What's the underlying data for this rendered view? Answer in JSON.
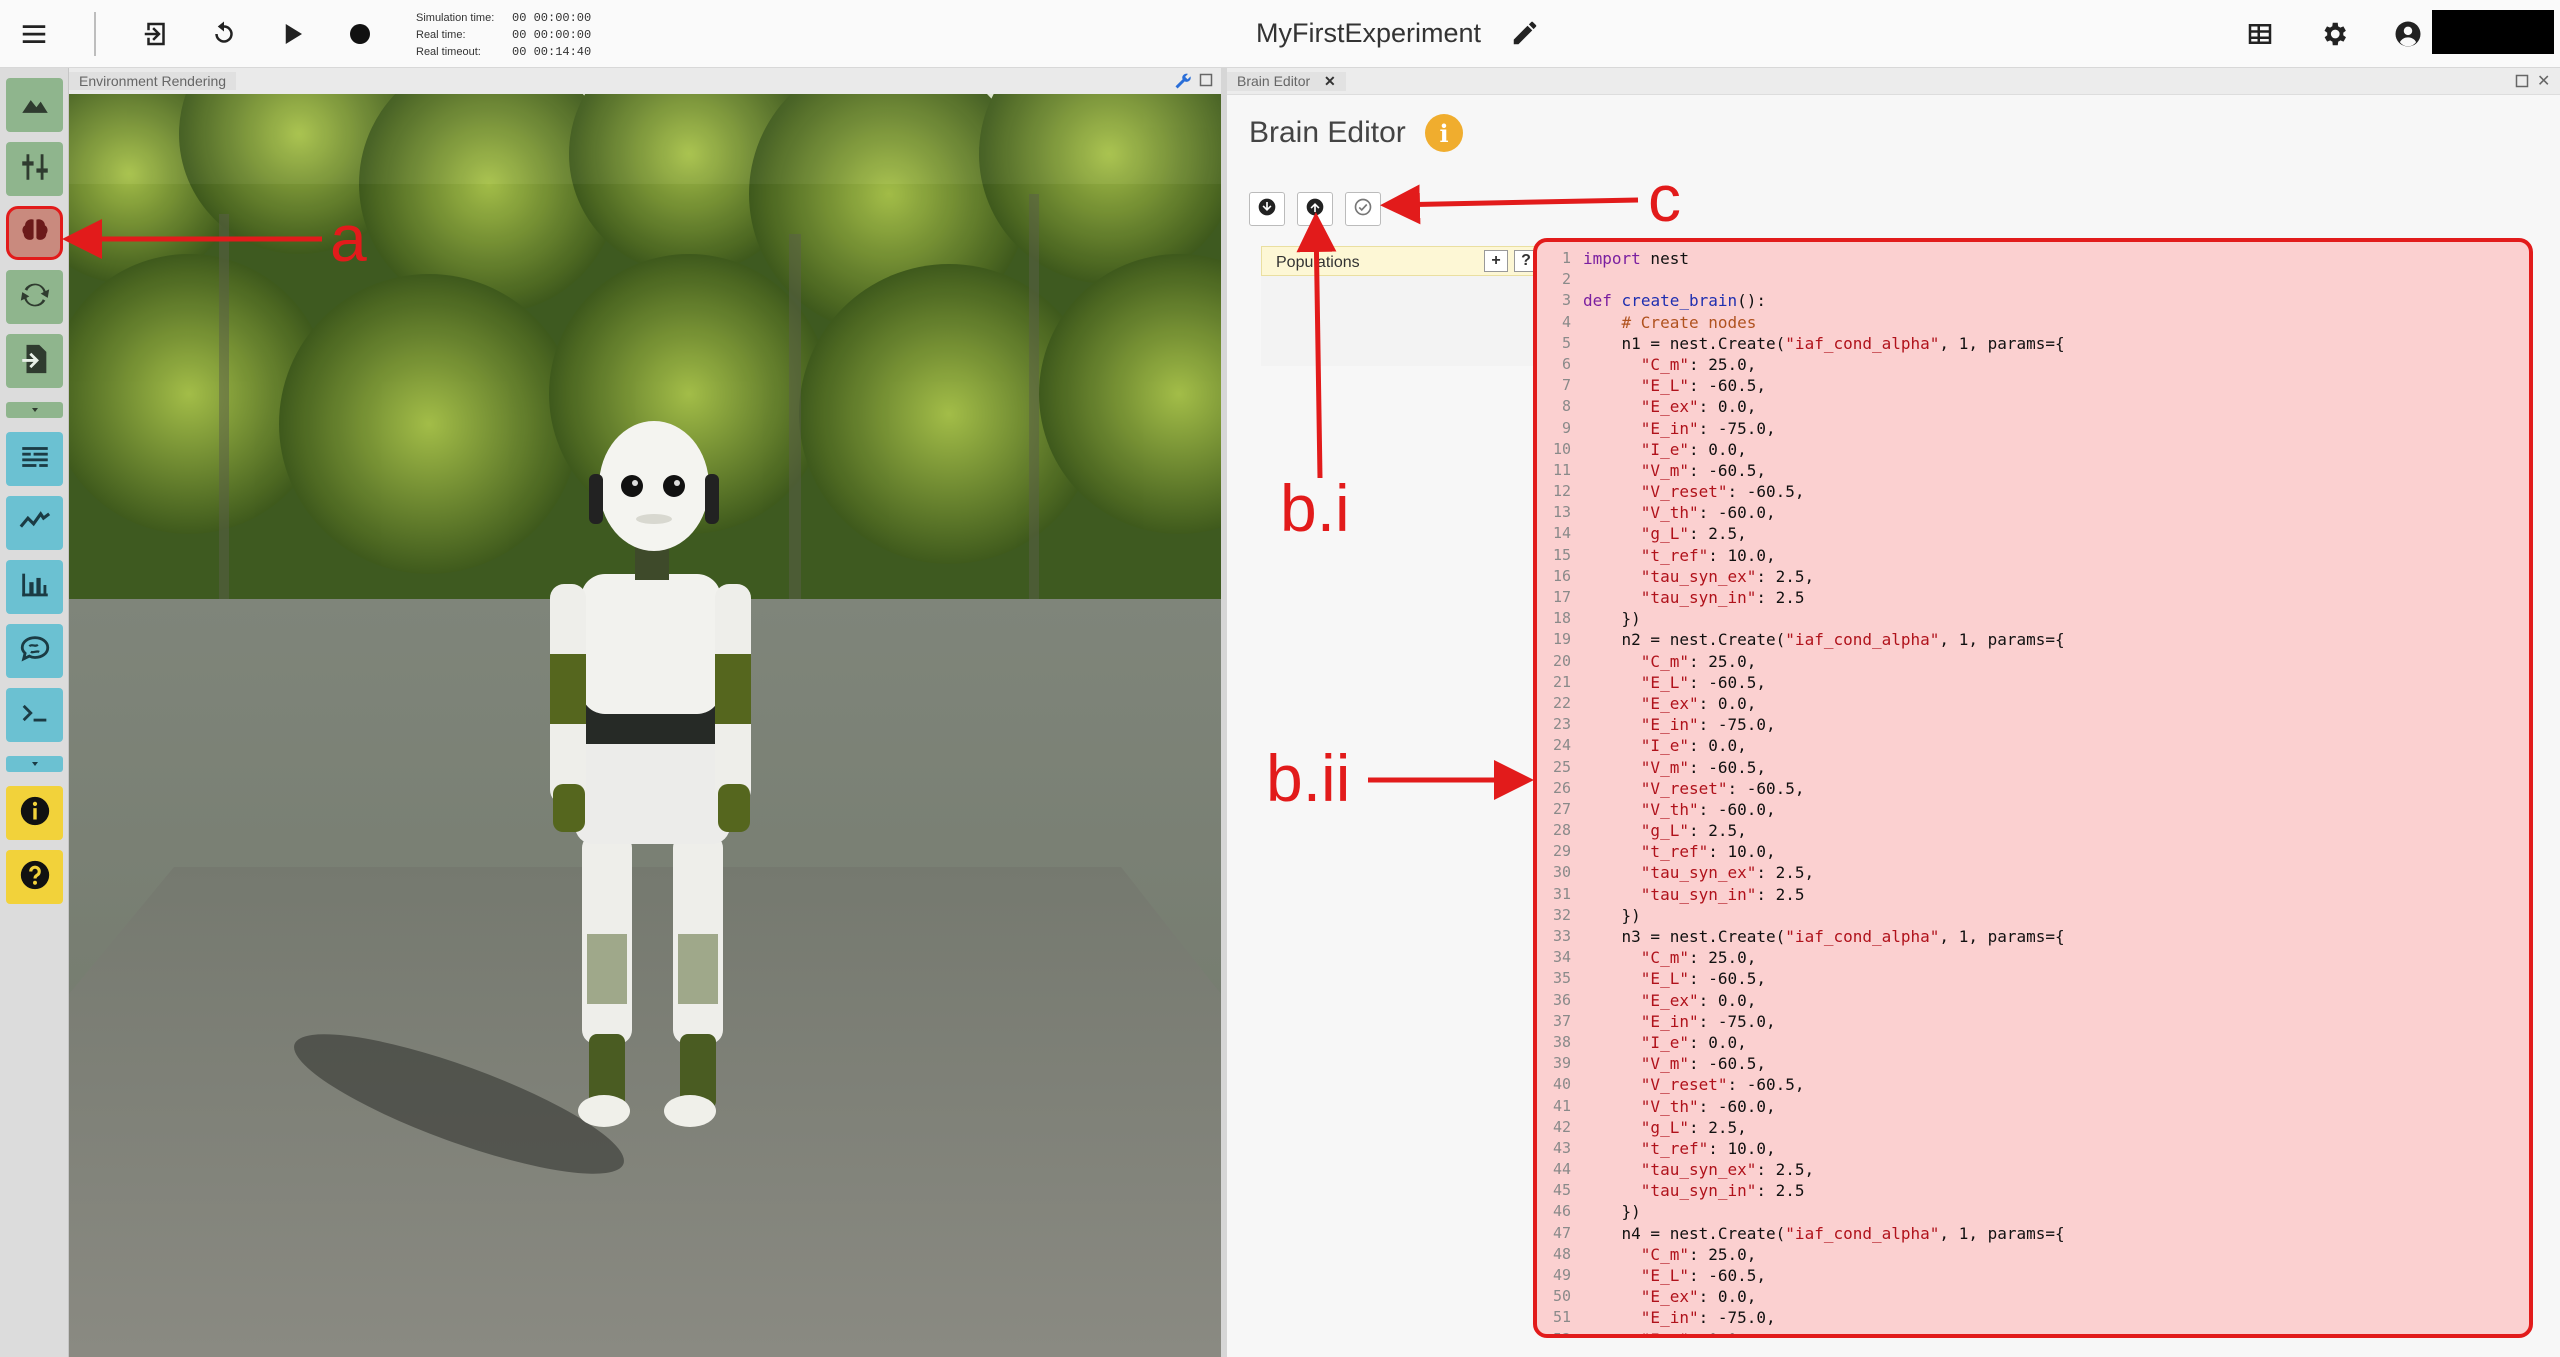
{
  "toolbar": {
    "icons": [
      "menu-icon",
      "exit-icon",
      "reset-icon",
      "play-icon",
      "record-icon"
    ],
    "time_info": [
      {
        "label": "Simulation time:",
        "value": "00 00:00:00"
      },
      {
        "label": "Real time:",
        "value": "00 00:00:00"
      },
      {
        "label": "Real timeout:",
        "value": "00 00:14:40"
      }
    ],
    "experiment_title": "MyFirstExperiment",
    "right_icons": [
      "layout-icon",
      "settings-icon",
      "user-icon"
    ]
  },
  "sidebar": {
    "buttons": [
      {
        "name": "environment-icon",
        "color": "#8fb58d"
      },
      {
        "name": "object-inspector-icon",
        "color": "#8fb58d"
      },
      {
        "name": "brain-icon",
        "color": "#8fb58d",
        "selected": true
      },
      {
        "name": "transfer-function-icon",
        "color": "#8fb58d"
      },
      {
        "name": "state-machine-icon",
        "color": "#8fb58d"
      },
      {
        "name": "log-console-icon",
        "color": "#6bc1d2"
      },
      {
        "name": "joint-plot-icon",
        "color": "#6bc1d2"
      },
      {
        "name": "spike-chart-icon",
        "color": "#6bc1d2"
      },
      {
        "name": "brain-visualizer-icon",
        "color": "#6bc1d2"
      },
      {
        "name": "terminal-icon",
        "color": "#6bc1d2"
      },
      {
        "name": "info-icon",
        "color": "#f2d23a"
      },
      {
        "name": "help-icon",
        "color": "#f2d23a"
      }
    ]
  },
  "env_panel": {
    "tab_label": "Environment Rendering"
  },
  "brain_editor": {
    "tab_label": "Brain Editor",
    "title": "Brain Editor",
    "info_glyph": "i",
    "tools": [
      "download-icon",
      "upload-icon",
      "apply-check-icon"
    ],
    "populations_label": "Populations",
    "pop_add": "+",
    "pop_help": "?"
  },
  "code": {
    "line_count": 52,
    "neurons": [
      "n1",
      "n2",
      "n3",
      "n4"
    ],
    "model": "\"iaf_cond_alpha\"",
    "params": [
      [
        "\"C_m\"",
        "25.0"
      ],
      [
        "\"E_L\"",
        "-60.5"
      ],
      [
        "\"E_ex\"",
        "0.0"
      ],
      [
        "\"E_in\"",
        "-75.0"
      ],
      [
        "\"I_e\"",
        "0.0"
      ],
      [
        "\"V_m\"",
        "-60.5"
      ],
      [
        "\"V_reset\"",
        "-60.5"
      ],
      [
        "\"V_th\"",
        "-60.0"
      ],
      [
        "\"g_L\"",
        "2.5"
      ],
      [
        "\"t_ref\"",
        "10.0"
      ],
      [
        "\"tau_syn_ex\"",
        "2.5"
      ],
      [
        "\"tau_syn_in\"",
        "2.5"
      ]
    ],
    "import_kw": "import",
    "import_mod": "nest",
    "def_kw": "def",
    "func_name": "create_brain",
    "comment": "# Create nodes"
  },
  "annotations": {
    "a": "a",
    "b_i": "b.i",
    "b_ii": "b.ii",
    "c": "c",
    "color": "#e21b1b"
  }
}
